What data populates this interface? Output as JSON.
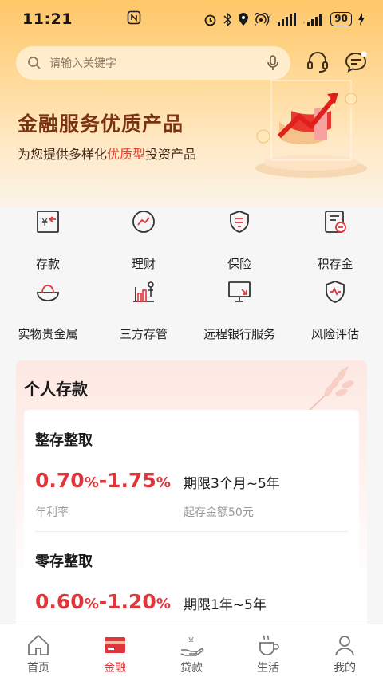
{
  "status_bar": {
    "time": "11:21",
    "battery": "90",
    "signal_network": "2"
  },
  "search": {
    "placeholder": "请输入关键字"
  },
  "hero": {
    "title": "金融服务优质产品",
    "subtitle_prefix": "为您提供多样化",
    "subtitle_highlight": "优质型",
    "subtitle_suffix": "投资产品"
  },
  "services": [
    {
      "label": "存款",
      "icon": "deposit-icon"
    },
    {
      "label": "理财",
      "icon": "wealth-icon"
    },
    {
      "label": "保险",
      "icon": "insurance-icon"
    },
    {
      "label": "积存金",
      "icon": "gold-accumulation-icon"
    },
    {
      "label": "实物贵金属",
      "icon": "gold-ingot-icon"
    },
    {
      "label": "三方存管",
      "icon": "custody-icon"
    },
    {
      "label": "远程银行服务",
      "icon": "remote-bank-icon"
    },
    {
      "label": "风险评估",
      "icon": "risk-shield-icon"
    }
  ],
  "panel": {
    "title": "个人存款",
    "products": [
      {
        "name": "整存整取",
        "rate_low": "0.70",
        "rate_high": "1.75",
        "percent": "%",
        "term": "期限3个月~5年",
        "rate_label": "年利率",
        "min_amount": "起存金额50元"
      },
      {
        "name": "零存整取",
        "rate_low": "0.60",
        "rate_high": "1.20",
        "percent": "%",
        "term": "期限1年~5年"
      }
    ]
  },
  "tabbar": [
    {
      "label": "首页",
      "icon": "home-icon",
      "active": false
    },
    {
      "label": "金融",
      "icon": "finance-card-icon",
      "active": true
    },
    {
      "label": "贷款",
      "icon": "loan-icon",
      "active": false
    },
    {
      "label": "生活",
      "icon": "coffee-icon",
      "active": false
    },
    {
      "label": "我的",
      "icon": "user-icon",
      "active": false
    }
  ],
  "colors": {
    "accent_red": "#e0353a",
    "hero_title": "#7a3210",
    "hero_bg": "#ffc768"
  }
}
